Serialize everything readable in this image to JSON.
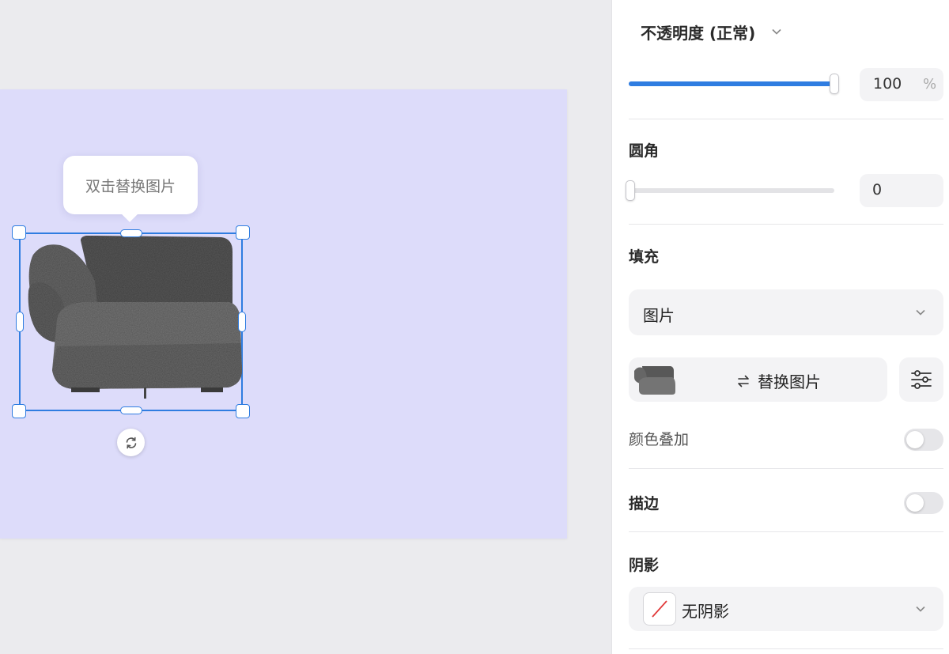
{
  "canvas": {
    "artboard_color": "#dddcfa",
    "tooltip_text": "双击替换图片",
    "selection_color": "#2f7de1"
  },
  "panel": {
    "opacity": {
      "title": "不透明度 (正常)",
      "value": "100",
      "unit": "%",
      "level": 1.0
    },
    "corner_radius": {
      "title": "圆角",
      "value": "0",
      "level": 0
    },
    "fill": {
      "title": "填充",
      "selected": "图片",
      "replace_label": "替换图片"
    },
    "color_overlay": {
      "label": "颜色叠加",
      "enabled": false
    },
    "stroke": {
      "title": "描边",
      "enabled": false
    },
    "shadow": {
      "title": "阴影",
      "selected": "无阴影"
    }
  },
  "icons": {
    "opacity_dropdown": "chevron-down-icon",
    "fill_dropdown": "chevron-down-icon",
    "shadow_dropdown": "chevron-down-icon",
    "replace": "swap-arrows-icon",
    "adjust": "sliders-icon",
    "rotate": "rotate-icon",
    "no_shadow": "no-shadow-swatch-icon"
  }
}
